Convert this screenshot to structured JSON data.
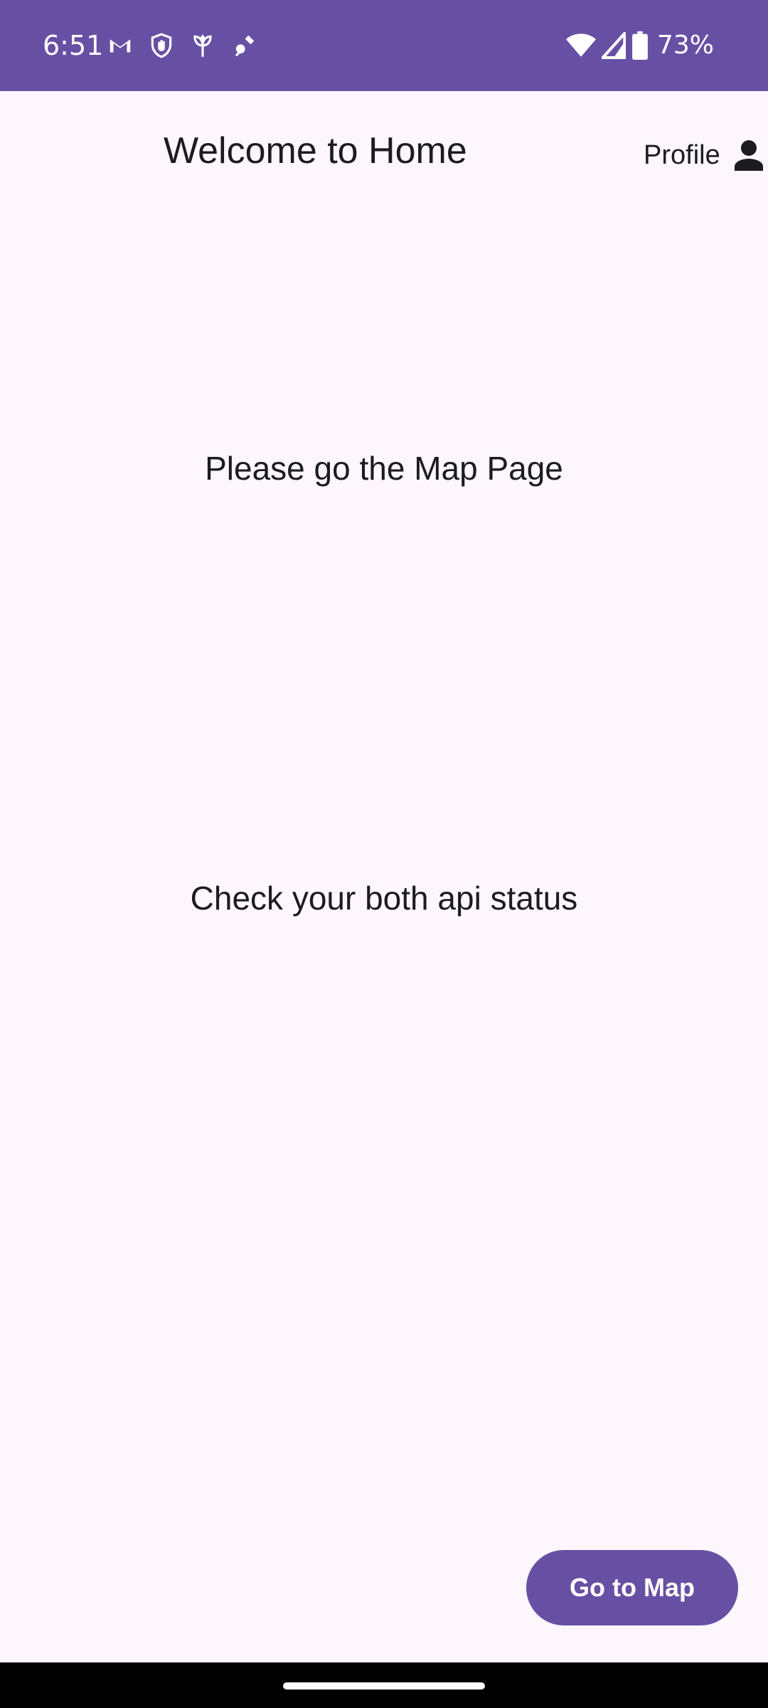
{
  "status_bar": {
    "time": "6:51",
    "battery_percent": "73%",
    "background_color": "#6750a4",
    "left_icons": [
      "gmail-icon",
      "shield-hand-icon",
      "plant-icon",
      "satellite-icon"
    ],
    "right_icons": [
      "wifi-icon",
      "cell-signal-icon",
      "battery-icon"
    ]
  },
  "header": {
    "title": "Welcome to Home",
    "profile_label": "Profile",
    "profile_icon": "person-icon"
  },
  "main": {
    "map_prompt": "Please go the Map Page",
    "api_status_text": "Check your both api status"
  },
  "actions": {
    "go_to_map_label": "Go to Map",
    "button_color": "#6750a4"
  },
  "theme": {
    "background_color": "#fdf7fd",
    "text_color": "#1c1b1f"
  }
}
